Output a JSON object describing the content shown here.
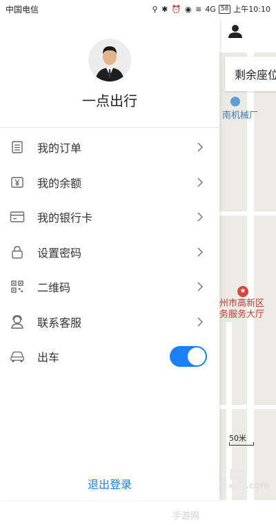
{
  "status_bar": {
    "carrier": "中国电信",
    "signal_label": "4G",
    "battery": "58",
    "time": "上午10:10"
  },
  "drawer": {
    "username": "一点出行",
    "menu": [
      {
        "label": "我的订单",
        "icon": "order-list-icon"
      },
      {
        "label": "我的余额",
        "icon": "balance-yen-icon"
      },
      {
        "label": "我的银行卡",
        "icon": "bank-card-icon"
      },
      {
        "label": "设置密码",
        "icon": "lock-icon"
      },
      {
        "label": "二维码",
        "icon": "qr-code-icon"
      },
      {
        "label": "联系客服",
        "icon": "customer-service-icon"
      }
    ],
    "depart": {
      "label": "出车",
      "enabled": true,
      "icon": "car-icon"
    },
    "logout_label": "退出登录"
  },
  "map": {
    "seats_label": "剩余座位",
    "poi_top": "南机械厂",
    "poi_bottom_line1": "州市高新区",
    "poi_bottom_line2": "务服务大厅",
    "scale_label": "50米"
  },
  "watermark": {
    "text": "2265",
    "sub": ".com手游网"
  },
  "colors": {
    "accent": "#1a7ff0",
    "poi_red": "#d9463b",
    "poi_blue": "#3a7bb8"
  }
}
